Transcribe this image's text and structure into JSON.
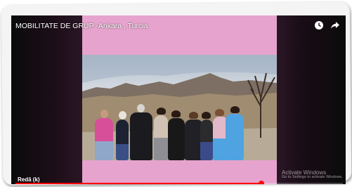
{
  "video": {
    "title": "MOBILITATE DE GRUP -Ankara , Turcia",
    "bottom_label": "Redă (k)",
    "progress": 0.75
  },
  "icons": {
    "top_right": [
      "clock-icon",
      "share-icon"
    ]
  },
  "watermark": {
    "title": "Activate Windows",
    "subtitle": "Go to Settings to activate Windows."
  },
  "colors": {
    "pink_frame": "#e6a3cd",
    "progress": "#ff0000",
    "player_bg": "#0d0d0d"
  }
}
